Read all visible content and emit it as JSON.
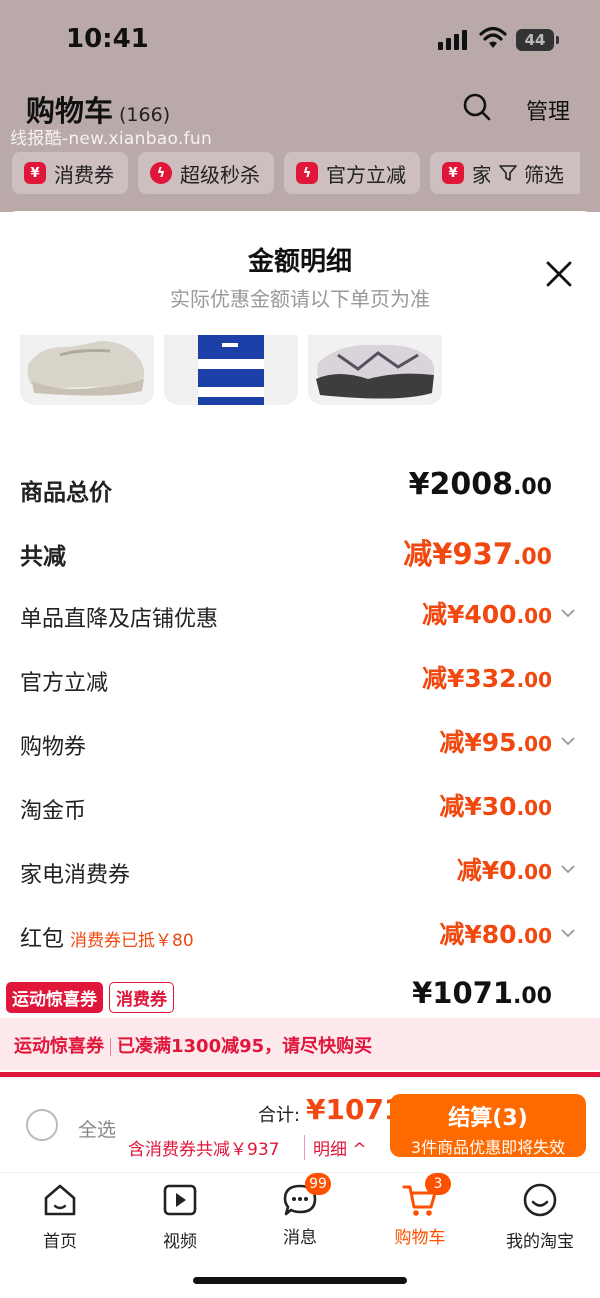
{
  "status_bar": {
    "time": "10:41",
    "battery": "44"
  },
  "background": {
    "title": "购物车",
    "count": "(166)",
    "manage": "管理",
    "watermark": "线报酷-new.xianbao.fun",
    "chips": [
      {
        "label": "消费券",
        "icon": "coupon-icon"
      },
      {
        "label": "超级秒杀",
        "icon": "flash-icon"
      },
      {
        "label": "官方立减",
        "icon": "flash-icon"
      },
      {
        "label": "家",
        "icon": "coupon-icon"
      }
    ],
    "filter": "筛选"
  },
  "sheet": {
    "title": "金额明细",
    "subtitle": "实际优惠金额请以下单页为准",
    "products": [
      "sneaker-beige",
      "tshirt-blue-stripe",
      "sneaker-grey"
    ],
    "rows": [
      {
        "label": "商品总价",
        "currency": "¥",
        "int": "2008",
        "dec": ".00",
        "style": "total",
        "chevron": false
      },
      {
        "label": "共减",
        "currency": "减¥",
        "int": "937",
        "dec": ".00",
        "style": "big",
        "chevron": false
      },
      {
        "label": "单品直降及店铺优惠",
        "currency": "减¥",
        "int": "400",
        "dec": ".00",
        "style": "normal",
        "chevron": true
      },
      {
        "label": "官方立减",
        "currency": "减¥",
        "int": "332",
        "dec": ".00",
        "style": "normal",
        "chevron": false
      },
      {
        "label": "购物券",
        "currency": "减¥",
        "int": "95",
        "dec": ".00",
        "style": "normal",
        "chevron": true
      },
      {
        "label": "淘金币",
        "currency": "减¥",
        "int": "30",
        "dec": ".00",
        "style": "normal",
        "chevron": false
      },
      {
        "label": "家电消费券",
        "currency": "减¥",
        "int": "0",
        "dec": ".00",
        "style": "normal",
        "chevron": true
      },
      {
        "label": "红包",
        "note": "消费券已抵￥80",
        "currency": "减¥",
        "int": "80",
        "dec": ".00",
        "style": "normal",
        "chevron": true
      }
    ],
    "promo_badge_1": "运动惊喜券",
    "promo_badge_2": "消费券",
    "final_currency": "¥",
    "final_int": "1071",
    "final_dec": ".00",
    "banner_part1": "运动惊喜券",
    "banner_part2": "已凑满1300减95，请尽快购买"
  },
  "bottom_bar": {
    "select_all": "全选",
    "total_label": "合计:",
    "total_value": "¥1071",
    "discount_text": "含消费券共减￥937",
    "detail_link": "明细 ^",
    "checkout_label": "结算(3)",
    "checkout_sub": "3件商品优惠即将失效"
  },
  "tabs": [
    {
      "label": "首页",
      "icon": "home-icon",
      "badge": "",
      "active": false
    },
    {
      "label": "视频",
      "icon": "video-icon",
      "badge": "",
      "active": false
    },
    {
      "label": "消息",
      "icon": "message-icon",
      "badge": "99",
      "active": false
    },
    {
      "label": "购物车",
      "icon": "cart-icon",
      "badge": "3",
      "active": true
    },
    {
      "label": "我的淘宝",
      "icon": "profile-icon",
      "badge": "",
      "active": false
    }
  ],
  "colors": {
    "accent": "#f0480f",
    "brand_red": "#e0163a",
    "checkout": "#ff6a00",
    "tab_active": "#ff5000"
  }
}
